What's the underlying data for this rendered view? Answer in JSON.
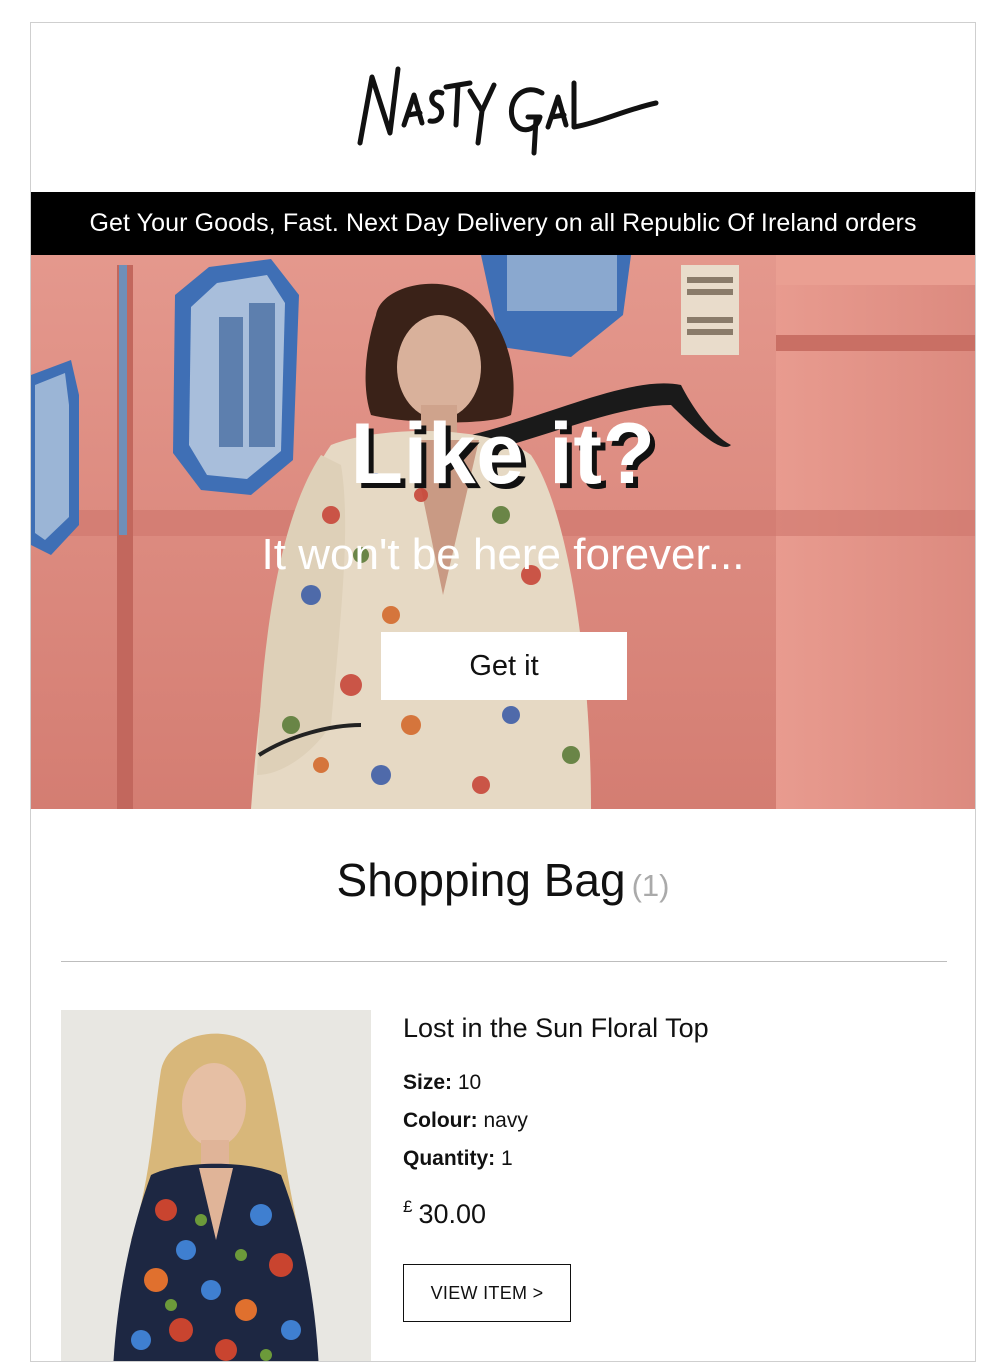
{
  "brand": {
    "logo_text": "NASTY GAL"
  },
  "promo_bar": {
    "text": "Get Your Goods, Fast. Next Day Delivery on all Republic Of Ireland orders"
  },
  "hero": {
    "title": "Like it?",
    "subtitle": "It won't be here forever...",
    "cta_label": "Get it"
  },
  "bag": {
    "title": "Shopping Bag",
    "count": "(1)"
  },
  "item": {
    "name": "Lost in the Sun Floral Top",
    "size_label": "Size:",
    "size_value": "10",
    "colour_label": "Colour:",
    "colour_value": "navy",
    "quantity_label": "Quantity:",
    "quantity_value": "1",
    "currency": "£",
    "price": "30.00",
    "view_label": "VIEW ITEM >"
  },
  "colors": {
    "promo_bg": "#000000",
    "hero_wall": "#d9857a",
    "window_trim": "#3f6fb5",
    "divider": "#bdbdbd"
  }
}
